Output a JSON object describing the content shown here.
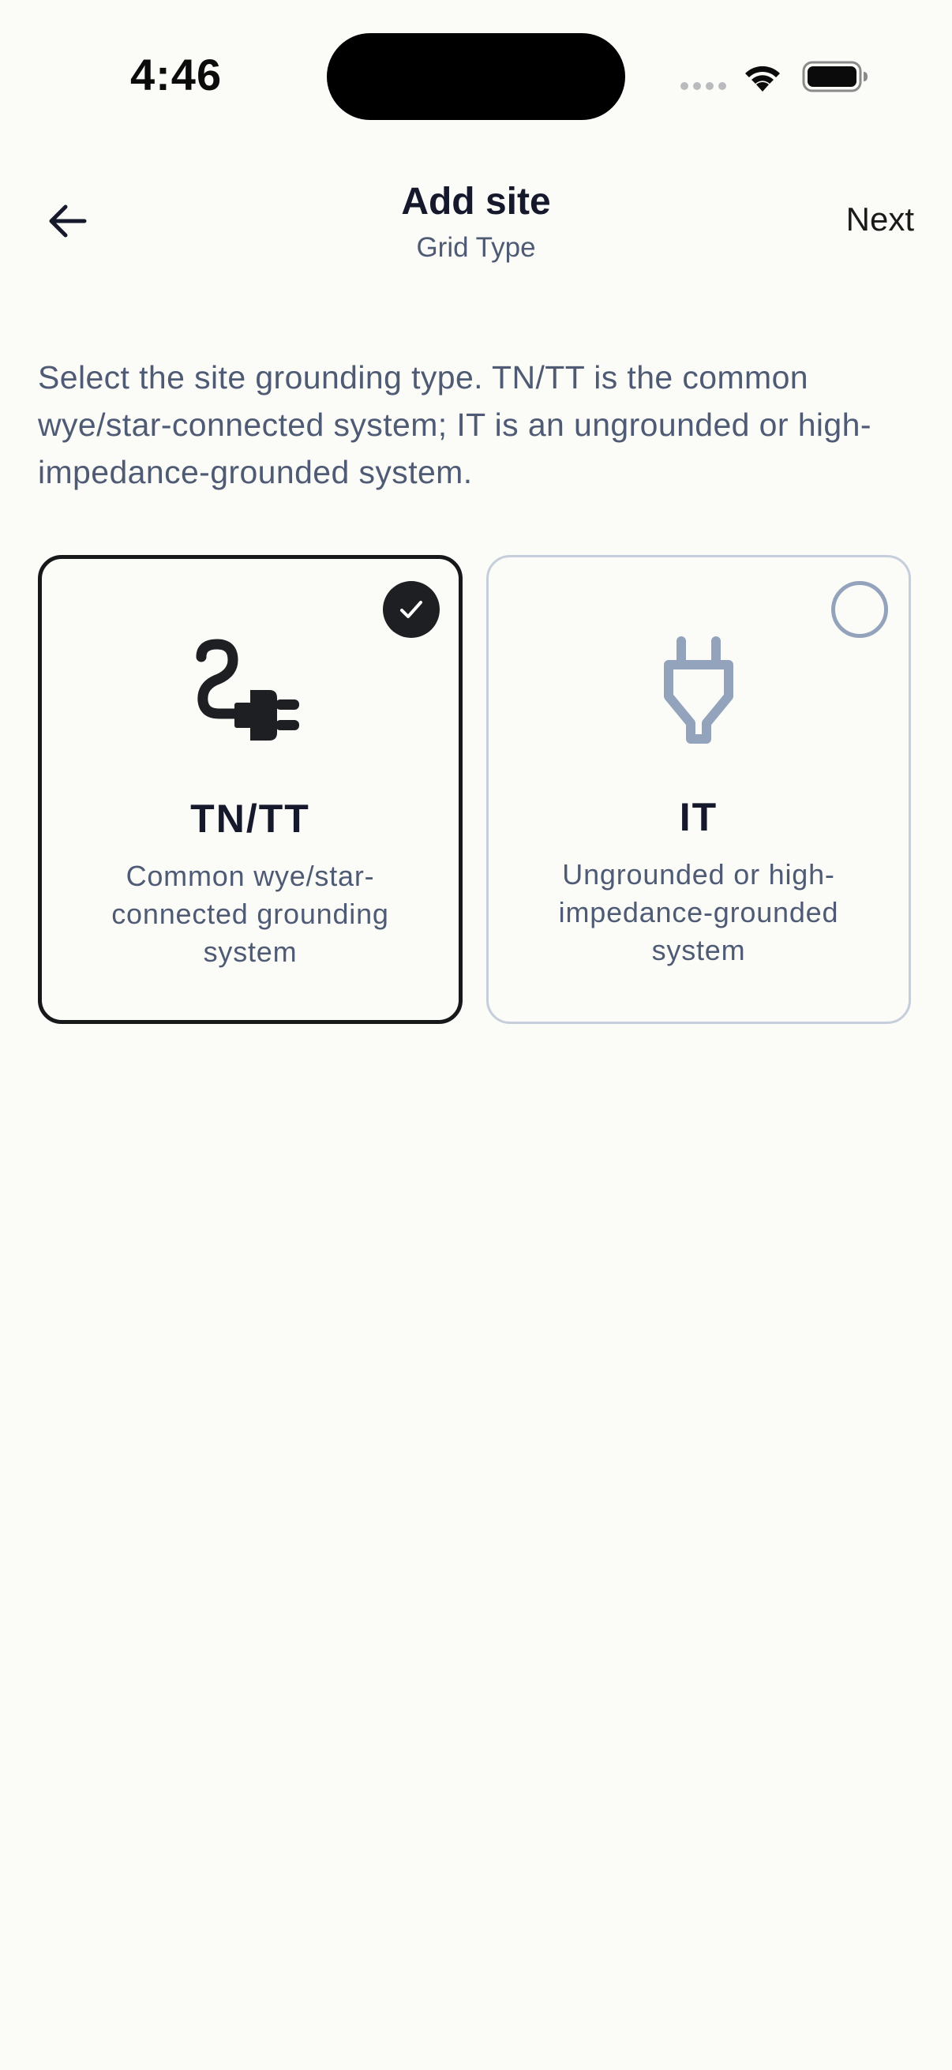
{
  "status_bar": {
    "time": "4:46"
  },
  "header": {
    "title": "Add site",
    "subtitle": "Grid Type",
    "next_label": "Next"
  },
  "description": "Select the site grounding type. TN/TT is the common wye/star-connected system; IT is an ungrounded or high-impedance-grounded system.",
  "options": [
    {
      "title": "TN/TT",
      "description": "Common wye/star-connected grounding system",
      "selected": true,
      "icon": "plug-cable-icon"
    },
    {
      "title": "IT",
      "description": "Ungrounded or high-impedance-grounded system",
      "selected": false,
      "icon": "plug-icon"
    }
  ],
  "colors": {
    "background": "#fbfbf8",
    "text_primary": "#16192c",
    "text_secondary": "#4f5b74",
    "selected_border": "#17181a",
    "unselected_border": "#c5ceda",
    "unselected_icon": "#94a3bc"
  }
}
